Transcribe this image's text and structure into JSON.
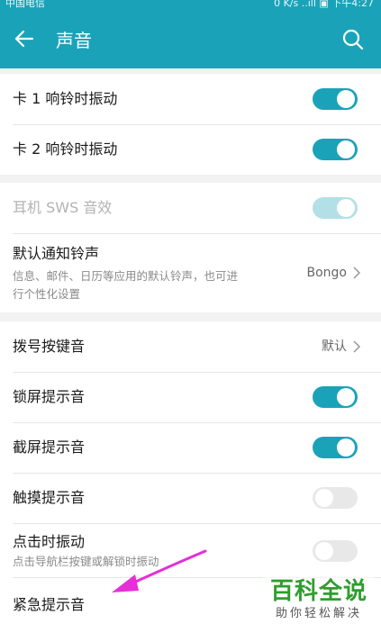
{
  "status_bar": {
    "carrier": "中国电信",
    "right_text": "0 K/s ..ıll ▣ 下午4:27"
  },
  "app_bar": {
    "title": "声音",
    "back_icon": "arrow-left-icon",
    "search_icon": "search-icon"
  },
  "groups": [
    {
      "rows": [
        {
          "label": "卡 1 响铃时振动",
          "toggle": "on"
        },
        {
          "label": "卡 2 响铃时振动",
          "toggle": "on"
        }
      ]
    },
    {
      "rows": [
        {
          "label": "耳机 SWS 音效",
          "toggle": "on-disabled",
          "disabled": true
        },
        {
          "label": "默认通知铃声",
          "sub": "信息、邮件、日历等应用的默认铃声，也可进行个性化设置",
          "value": "Bongo"
        }
      ]
    },
    {
      "rows": [
        {
          "label": "拨号按键音",
          "value": "默认"
        },
        {
          "label": "锁屏提示音",
          "toggle": "on"
        },
        {
          "label": "截屏提示音",
          "toggle": "on"
        },
        {
          "label": "触摸提示音",
          "toggle": "off"
        },
        {
          "label": "点击时振动",
          "sub": "点击导航栏按键或解锁时振动",
          "toggle": "off"
        },
        {
          "label": "紧急提示音"
        }
      ]
    }
  ],
  "watermark": {
    "main": "百科全说",
    "sub": "助你轻松解决"
  },
  "colors": {
    "accent": "#1aa3b8",
    "annotation_arrow": "#e62fd8",
    "watermark_green": "#2e9e2e"
  }
}
